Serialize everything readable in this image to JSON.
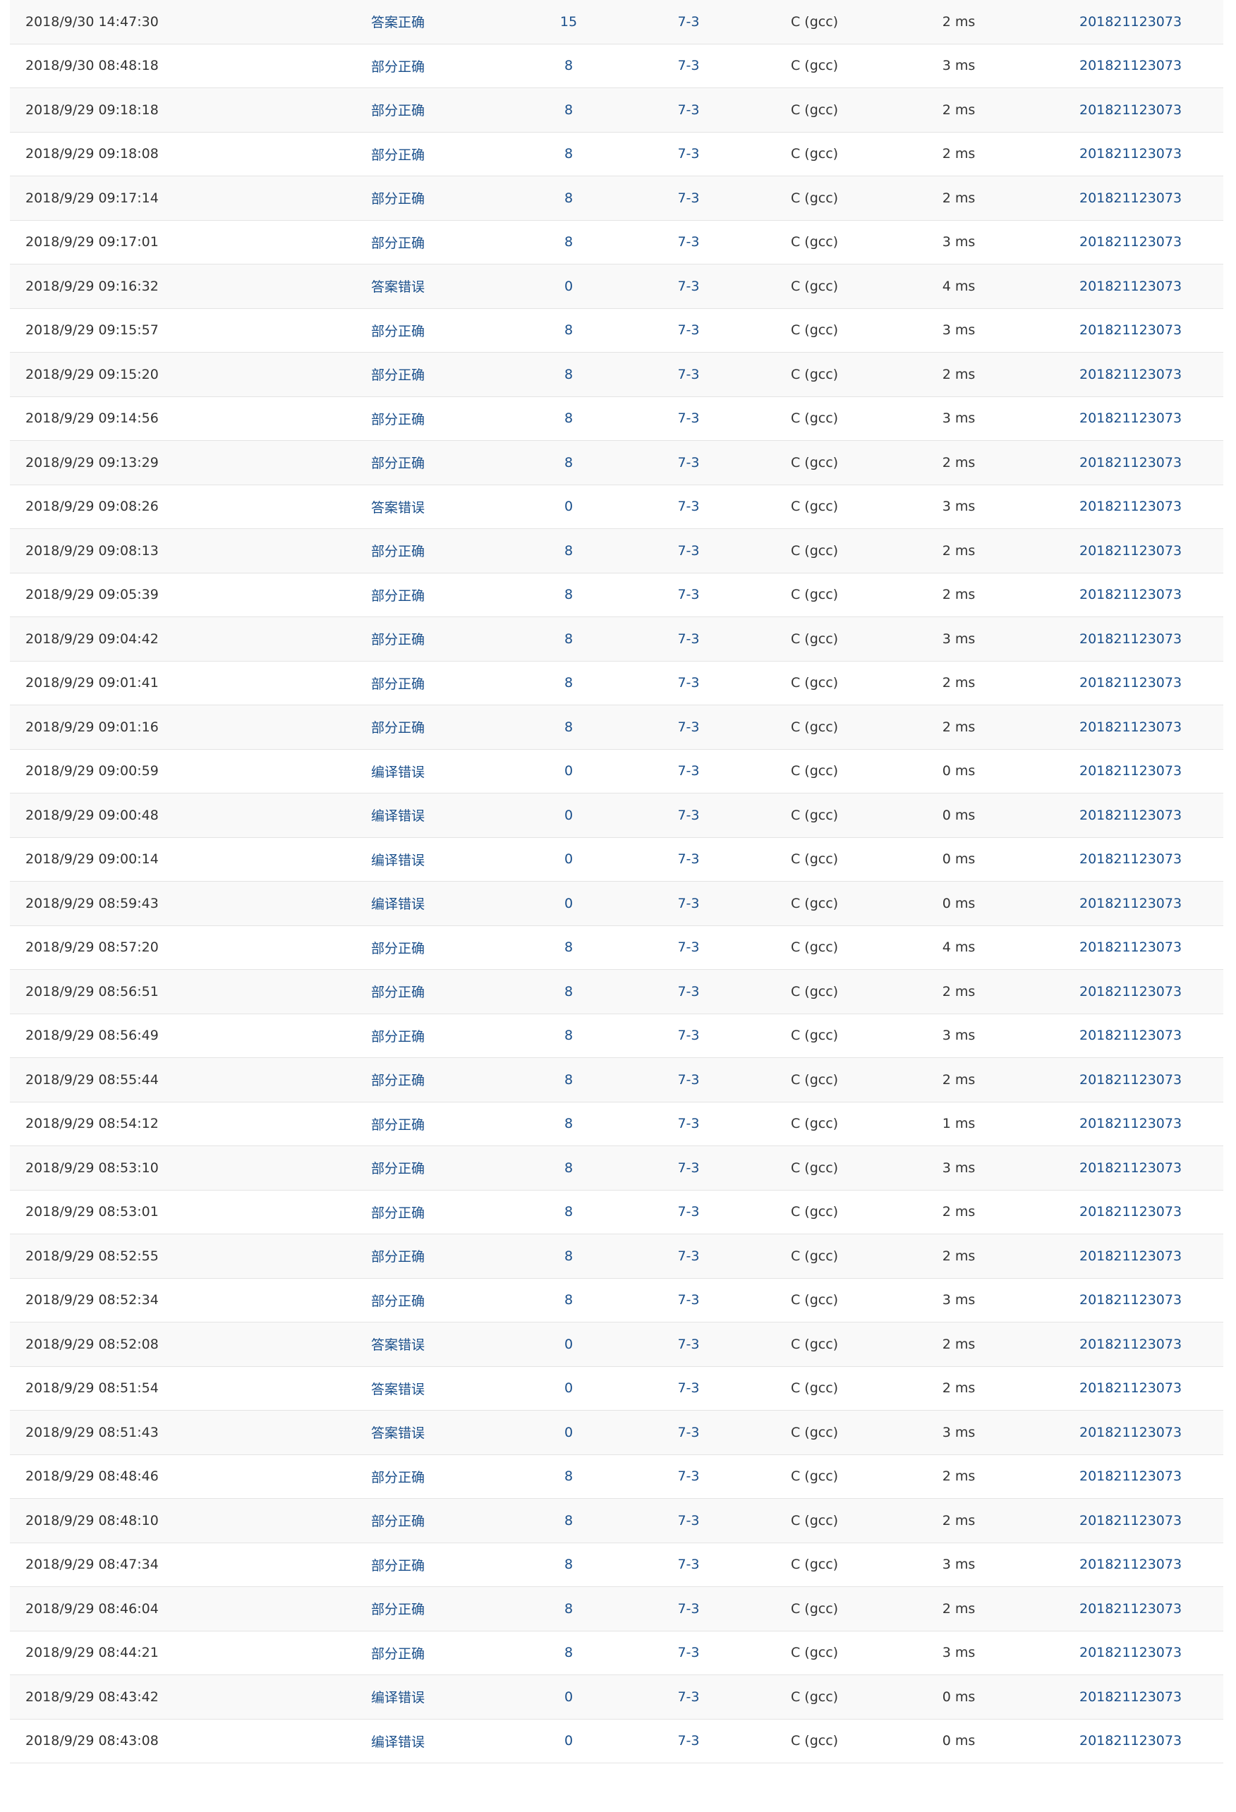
{
  "colors": {
    "accepted": "#e74c3c",
    "partial": "#4caf50",
    "wrong": "#4caf50",
    "compile_error": "#2aa1d8",
    "link": "#1a4f8b"
  },
  "submissions": [
    {
      "time": "2018/9/30 14:47:30",
      "status": "答案正确",
      "status_type": "accepted",
      "score": "15",
      "problem": "7-3",
      "compiler": "C (gcc)",
      "time_used": "2 ms",
      "user": "201821123073"
    },
    {
      "time": "2018/9/30 08:48:18",
      "status": "部分正确",
      "status_type": "partial",
      "score": "8",
      "problem": "7-3",
      "compiler": "C (gcc)",
      "time_used": "3 ms",
      "user": "201821123073"
    },
    {
      "time": "2018/9/29 09:18:18",
      "status": "部分正确",
      "status_type": "partial",
      "score": "8",
      "problem": "7-3",
      "compiler": "C (gcc)",
      "time_used": "2 ms",
      "user": "201821123073"
    },
    {
      "time": "2018/9/29 09:18:08",
      "status": "部分正确",
      "status_type": "partial",
      "score": "8",
      "problem": "7-3",
      "compiler": "C (gcc)",
      "time_used": "2 ms",
      "user": "201821123073"
    },
    {
      "time": "2018/9/29 09:17:14",
      "status": "部分正确",
      "status_type": "partial",
      "score": "8",
      "problem": "7-3",
      "compiler": "C (gcc)",
      "time_used": "2 ms",
      "user": "201821123073"
    },
    {
      "time": "2018/9/29 09:17:01",
      "status": "部分正确",
      "status_type": "partial",
      "score": "8",
      "problem": "7-3",
      "compiler": "C (gcc)",
      "time_used": "3 ms",
      "user": "201821123073"
    },
    {
      "time": "2018/9/29 09:16:32",
      "status": "答案错误",
      "status_type": "wrong",
      "score": "0",
      "problem": "7-3",
      "compiler": "C (gcc)",
      "time_used": "4 ms",
      "user": "201821123073"
    },
    {
      "time": "2018/9/29 09:15:57",
      "status": "部分正确",
      "status_type": "partial",
      "score": "8",
      "problem": "7-3",
      "compiler": "C (gcc)",
      "time_used": "3 ms",
      "user": "201821123073"
    },
    {
      "time": "2018/9/29 09:15:20",
      "status": "部分正确",
      "status_type": "partial",
      "score": "8",
      "problem": "7-3",
      "compiler": "C (gcc)",
      "time_used": "2 ms",
      "user": "201821123073"
    },
    {
      "time": "2018/9/29 09:14:56",
      "status": "部分正确",
      "status_type": "partial",
      "score": "8",
      "problem": "7-3",
      "compiler": "C (gcc)",
      "time_used": "3 ms",
      "user": "201821123073"
    },
    {
      "time": "2018/9/29 09:13:29",
      "status": "部分正确",
      "status_type": "partial",
      "score": "8",
      "problem": "7-3",
      "compiler": "C (gcc)",
      "time_used": "2 ms",
      "user": "201821123073"
    },
    {
      "time": "2018/9/29 09:08:26",
      "status": "答案错误",
      "status_type": "wrong",
      "score": "0",
      "problem": "7-3",
      "compiler": "C (gcc)",
      "time_used": "3 ms",
      "user": "201821123073"
    },
    {
      "time": "2018/9/29 09:08:13",
      "status": "部分正确",
      "status_type": "partial",
      "score": "8",
      "problem": "7-3",
      "compiler": "C (gcc)",
      "time_used": "2 ms",
      "user": "201821123073"
    },
    {
      "time": "2018/9/29 09:05:39",
      "status": "部分正确",
      "status_type": "partial",
      "score": "8",
      "problem": "7-3",
      "compiler": "C (gcc)",
      "time_used": "2 ms",
      "user": "201821123073"
    },
    {
      "time": "2018/9/29 09:04:42",
      "status": "部分正确",
      "status_type": "partial",
      "score": "8",
      "problem": "7-3",
      "compiler": "C (gcc)",
      "time_used": "3 ms",
      "user": "201821123073"
    },
    {
      "time": "2018/9/29 09:01:41",
      "status": "部分正确",
      "status_type": "partial",
      "score": "8",
      "problem": "7-3",
      "compiler": "C (gcc)",
      "time_used": "2 ms",
      "user": "201821123073"
    },
    {
      "time": "2018/9/29 09:01:16",
      "status": "部分正确",
      "status_type": "partial",
      "score": "8",
      "problem": "7-3",
      "compiler": "C (gcc)",
      "time_used": "2 ms",
      "user": "201821123073"
    },
    {
      "time": "2018/9/29 09:00:59",
      "status": "编译错误",
      "status_type": "compile",
      "score": "0",
      "problem": "7-3",
      "compiler": "C (gcc)",
      "time_used": "0 ms",
      "user": "201821123073"
    },
    {
      "time": "2018/9/29 09:00:48",
      "status": "编译错误",
      "status_type": "compile",
      "score": "0",
      "problem": "7-3",
      "compiler": "C (gcc)",
      "time_used": "0 ms",
      "user": "201821123073"
    },
    {
      "time": "2018/9/29 09:00:14",
      "status": "编译错误",
      "status_type": "compile",
      "score": "0",
      "problem": "7-3",
      "compiler": "C (gcc)",
      "time_used": "0 ms",
      "user": "201821123073"
    },
    {
      "time": "2018/9/29 08:59:43",
      "status": "编译错误",
      "status_type": "compile",
      "score": "0",
      "problem": "7-3",
      "compiler": "C (gcc)",
      "time_used": "0 ms",
      "user": "201821123073"
    },
    {
      "time": "2018/9/29 08:57:20",
      "status": "部分正确",
      "status_type": "partial",
      "score": "8",
      "problem": "7-3",
      "compiler": "C (gcc)",
      "time_used": "4 ms",
      "user": "201821123073"
    },
    {
      "time": "2018/9/29 08:56:51",
      "status": "部分正确",
      "status_type": "partial",
      "score": "8",
      "problem": "7-3",
      "compiler": "C (gcc)",
      "time_used": "2 ms",
      "user": "201821123073"
    },
    {
      "time": "2018/9/29 08:56:49",
      "status": "部分正确",
      "status_type": "partial",
      "score": "8",
      "problem": "7-3",
      "compiler": "C (gcc)",
      "time_used": "3 ms",
      "user": "201821123073"
    },
    {
      "time": "2018/9/29 08:55:44",
      "status": "部分正确",
      "status_type": "partial",
      "score": "8",
      "problem": "7-3",
      "compiler": "C (gcc)",
      "time_used": "2 ms",
      "user": "201821123073"
    },
    {
      "time": "2018/9/29 08:54:12",
      "status": "部分正确",
      "status_type": "partial",
      "score": "8",
      "problem": "7-3",
      "compiler": "C (gcc)",
      "time_used": "1 ms",
      "user": "201821123073"
    },
    {
      "time": "2018/9/29 08:53:10",
      "status": "部分正确",
      "status_type": "partial",
      "score": "8",
      "problem": "7-3",
      "compiler": "C (gcc)",
      "time_used": "3 ms",
      "user": "201821123073"
    },
    {
      "time": "2018/9/29 08:53:01",
      "status": "部分正确",
      "status_type": "partial",
      "score": "8",
      "problem": "7-3",
      "compiler": "C (gcc)",
      "time_used": "2 ms",
      "user": "201821123073"
    },
    {
      "time": "2018/9/29 08:52:55",
      "status": "部分正确",
      "status_type": "partial",
      "score": "8",
      "problem": "7-3",
      "compiler": "C (gcc)",
      "time_used": "2 ms",
      "user": "201821123073"
    },
    {
      "time": "2018/9/29 08:52:34",
      "status": "部分正确",
      "status_type": "partial",
      "score": "8",
      "problem": "7-3",
      "compiler": "C (gcc)",
      "time_used": "3 ms",
      "user": "201821123073"
    },
    {
      "time": "2018/9/29 08:52:08",
      "status": "答案错误",
      "status_type": "wrong",
      "score": "0",
      "problem": "7-3",
      "compiler": "C (gcc)",
      "time_used": "2 ms",
      "user": "201821123073"
    },
    {
      "time": "2018/9/29 08:51:54",
      "status": "答案错误",
      "status_type": "wrong",
      "score": "0",
      "problem": "7-3",
      "compiler": "C (gcc)",
      "time_used": "2 ms",
      "user": "201821123073"
    },
    {
      "time": "2018/9/29 08:51:43",
      "status": "答案错误",
      "status_type": "wrong",
      "score": "0",
      "problem": "7-3",
      "compiler": "C (gcc)",
      "time_used": "3 ms",
      "user": "201821123073"
    },
    {
      "time": "2018/9/29 08:48:46",
      "status": "部分正确",
      "status_type": "partial",
      "score": "8",
      "problem": "7-3",
      "compiler": "C (gcc)",
      "time_used": "2 ms",
      "user": "201821123073"
    },
    {
      "time": "2018/9/29 08:48:10",
      "status": "部分正确",
      "status_type": "partial",
      "score": "8",
      "problem": "7-3",
      "compiler": "C (gcc)",
      "time_used": "2 ms",
      "user": "201821123073"
    },
    {
      "time": "2018/9/29 08:47:34",
      "status": "部分正确",
      "status_type": "partial",
      "score": "8",
      "problem": "7-3",
      "compiler": "C (gcc)",
      "time_used": "3 ms",
      "user": "201821123073"
    },
    {
      "time": "2018/9/29 08:46:04",
      "status": "部分正确",
      "status_type": "partial",
      "score": "8",
      "problem": "7-3",
      "compiler": "C (gcc)",
      "time_used": "2 ms",
      "user": "201821123073"
    },
    {
      "time": "2018/9/29 08:44:21",
      "status": "部分正确",
      "status_type": "partial",
      "score": "8",
      "problem": "7-3",
      "compiler": "C (gcc)",
      "time_used": "3 ms",
      "user": "201821123073"
    },
    {
      "time": "2018/9/29 08:43:42",
      "status": "编译错误",
      "status_type": "compile",
      "score": "0",
      "problem": "7-3",
      "compiler": "C (gcc)",
      "time_used": "0 ms",
      "user": "201821123073"
    },
    {
      "time": "2018/9/29 08:43:08",
      "status": "编译错误",
      "status_type": "compile",
      "score": "0",
      "problem": "7-3",
      "compiler": "C (gcc)",
      "time_used": "0 ms",
      "user": "201821123073"
    }
  ]
}
